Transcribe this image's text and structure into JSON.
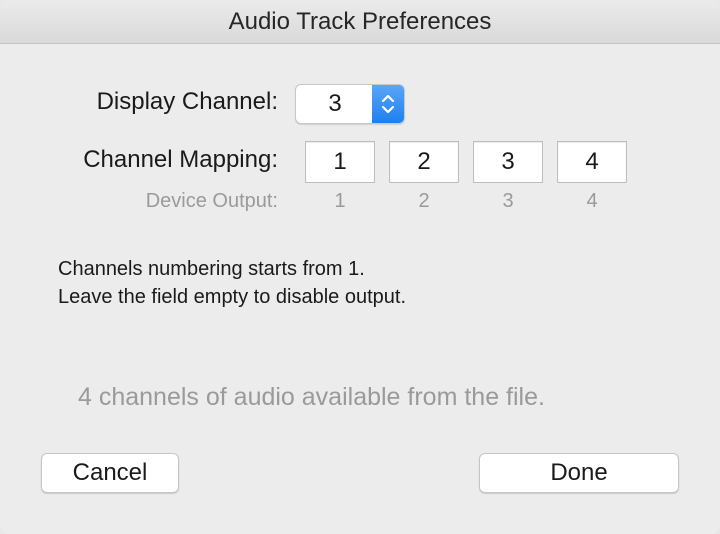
{
  "window": {
    "title": "Audio Track Preferences"
  },
  "display_channel": {
    "label": "Display Channel:",
    "value": "3",
    "stepper_icon": "chevron-up-down-icon"
  },
  "channel_mapping": {
    "label": "Channel Mapping:",
    "fields": [
      "1",
      "2",
      "3",
      "4"
    ]
  },
  "device_output": {
    "label": "Device Output:",
    "numbers": [
      "1",
      "2",
      "3",
      "4"
    ]
  },
  "info": {
    "line1": "Channels numbering starts from 1.",
    "line2": "Leave the field empty to disable output."
  },
  "availability": "4 channels of audio available from the file.",
  "buttons": {
    "cancel": "Cancel",
    "done": "Done"
  },
  "colors": {
    "accent": "#1e7ff0",
    "muted_text": "#9a9a9a",
    "background": "#ececec"
  }
}
